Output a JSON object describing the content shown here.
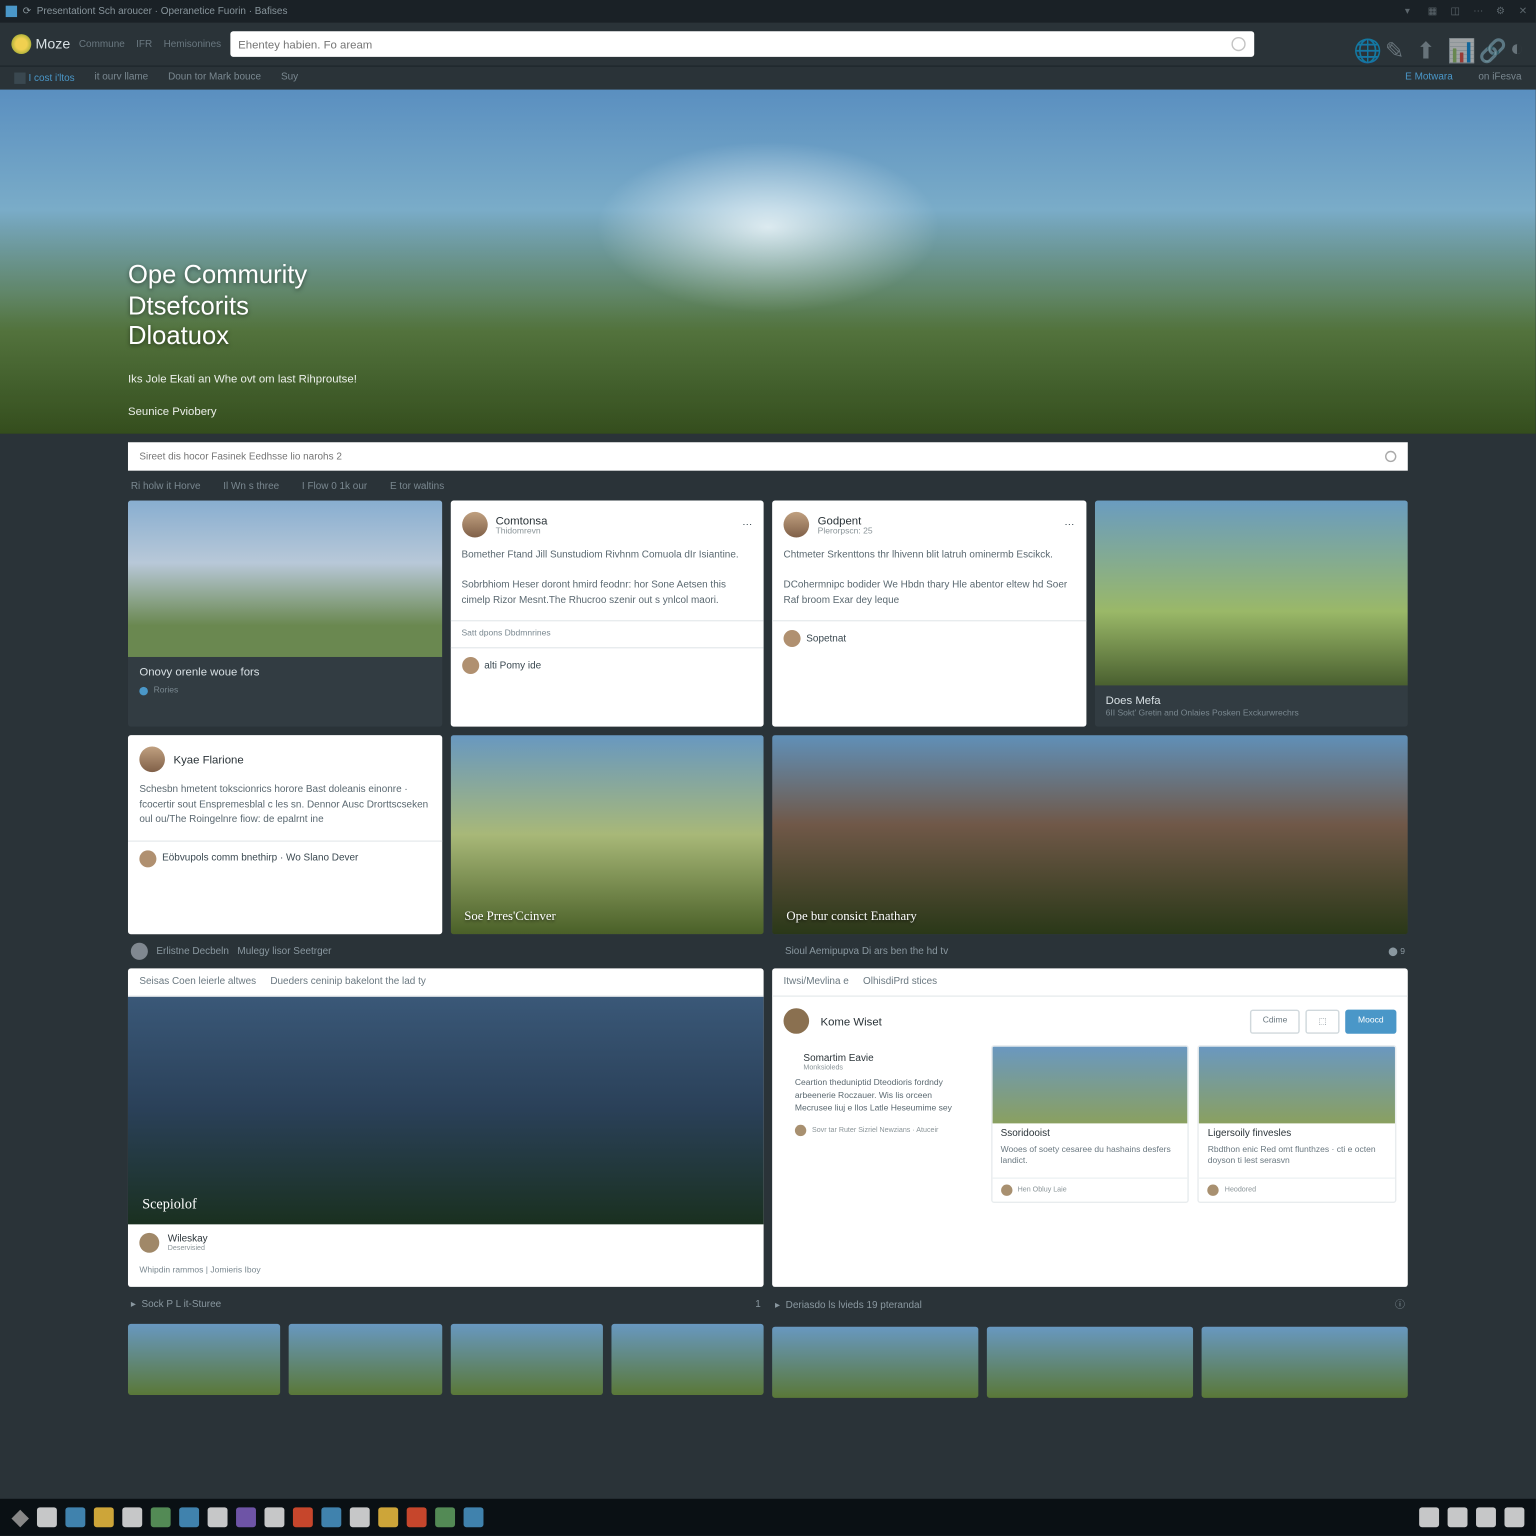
{
  "titlebar": {
    "app": "Browser",
    "tab": "Presentationt Sch aroucer · Operanetice Fuorin · Bafises"
  },
  "header": {
    "logo": "Moze",
    "crumbs": [
      "Commune",
      "IFR",
      "Hemisonines"
    ],
    "search_placeholder": "Ehentey habien. Fo aream",
    "nav": [
      "I cost i'ltos",
      "it ourv llame",
      "Doun tor Mark bouce",
      "Suy"
    ],
    "nav_r": [
      "E Motwara",
      "on iFesva"
    ]
  },
  "hero": {
    "line1": "Ope Commurity",
    "line2": "Dtsefcorits",
    "line3": "Dloatuox",
    "sub1": "Iks Jole Ekati an Whe ovt om last Rihproutse!",
    "sub2": "Seunice Pviobery"
  },
  "filter": {
    "placeholder": "Sireet dis hocor Fasinek Eedhsse lio narohs 2"
  },
  "tabs": [
    "Ri holw it Horve",
    "Il Wn s three",
    "I Flow 0 1k our",
    "E tor waltins"
  ],
  "cards": {
    "c1": {
      "title": "Onovy orenle woue fors",
      "sub": "Rories"
    },
    "c2": {
      "name": "Comtonsa",
      "date": "Thidomrevn",
      "p1": "Bomether Ftand Jill Sunstudiom Rivhnm Comuola dIr Isiantine.",
      "p2": "Sobrbhiom Heser doront hmird feodnr: hor Sone Aetsen this cimelp Rizor Mesnt.The Rhucroo szenir out s ynlcol maori.",
      "cap": "Satt dpons Dbdmnrines",
      "ft": "alti Pomy ide"
    },
    "c3": {
      "name": "Godpent",
      "date": "Plerorpscn: 25",
      "p1": "Chtmeter Srkenttons thr lhivenn blit latruh ominermb Escikck.",
      "p2": "DCohermnipc bodider We Hbdn thary Hle abentor eltew hd Soer Raf broom Exar dey leque",
      "ft": "Sopetnat"
    },
    "c4": {
      "title": "Does Mefa",
      "sub": "6II Sokt' Gretin and Onlaies Posken Exckurwrechrs"
    },
    "c5": {
      "name": "Kyae Flarione",
      "date": "",
      "p1": "Schesbn hmetent tokscionrics horore Bast doleanis einonre · fcocertir sout Enspremesblal c les sn. Dennor Ausc Drorttscseken oul ou/The Roingelnre fiow: de epalrnt ine",
      "cap": "Eöbvupols comm bnethirp · Wo Slano Dever"
    },
    "c6": {
      "title": "Soe Prres'Ccinver"
    },
    "c7": {
      "title": "Ope bur consict Enathary"
    }
  },
  "sec1": {
    "name": "Erlistne Decbeln",
    "sub": "Mulegy lisor Seetrger",
    "r": "Sioul Aemipupva Di ars ben the hd tv"
  },
  "panelL": {
    "tabs": [
      "Seisas Coen leierle altwes",
      "Dueders ceninip bakelont the lad ty"
    ],
    "img": "Scepiolof",
    "user": "Wileskay",
    "usub": "Deservisied",
    "link": "Whipdin rammos | Jomieris Iboy"
  },
  "panelR": {
    "hdr": [
      "Itwsi/Mevlina e",
      "OlhisdiPrd stices"
    ],
    "user": "Kome Wiset",
    "usub": "",
    "btn1": "Cdime",
    "btn2": "Moocd",
    "post": {
      "name": "Somartim Eavie",
      "date": "Monksioleds",
      "body": "Ceartion theduniptid Dteodioris fordndy arbeenerie Roczauer. Wis lis orceen Mecrusee liuj e llos Latle Heseumime sey"
    },
    "mini1": {
      "t": "Ssoridooist",
      "b": "Wooes of soety cesaree du hashains desfers landict.",
      "f": "Hen Obluy Laie"
    },
    "mini2": {
      "t": "Ligersoily finvesles",
      "b": "Rbdthon enic Red omt flunthzes · cti e octen doyson ti lest serasvn",
      "f": "Heodored"
    },
    "ft": "Sovr tar Ruter Sizriel Newzians · Atuceir"
  },
  "strip": {
    "l": "Sock P L it-Sturee",
    "r": "Deriasdo ls lvieds 19 pterandal"
  }
}
